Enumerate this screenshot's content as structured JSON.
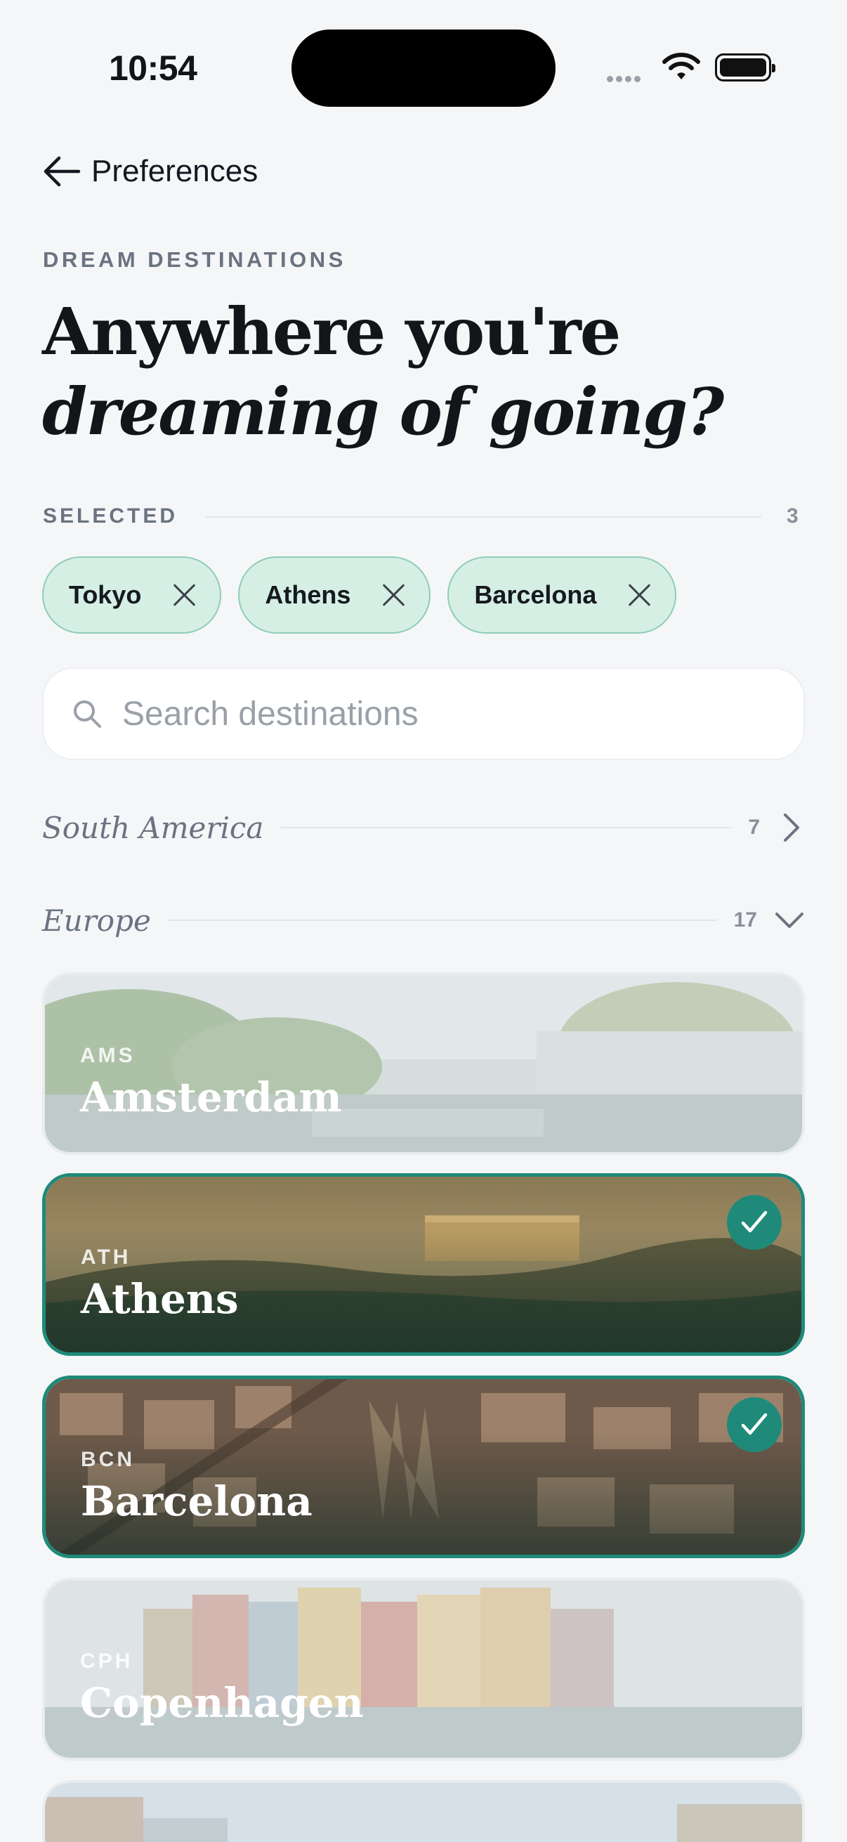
{
  "status_bar": {
    "time": "10:54"
  },
  "nav": {
    "back_label": "Preferences"
  },
  "header": {
    "eyebrow": "DREAM DESTINATIONS",
    "title_line1": "Anywhere you're",
    "title_line2": "dreaming of going?"
  },
  "selected": {
    "label": "SELECTED",
    "count": "3",
    "chips": [
      {
        "label": "Tokyo"
      },
      {
        "label": "Athens"
      },
      {
        "label": "Barcelona"
      }
    ]
  },
  "search": {
    "placeholder": "Search destinations",
    "value": ""
  },
  "regions": [
    {
      "name": "South America",
      "count": "7",
      "expanded": false
    },
    {
      "name": "Europe",
      "count": "17",
      "expanded": true
    }
  ],
  "destinations": [
    {
      "code": "AMS",
      "city": "Amsterdam",
      "selected": false
    },
    {
      "code": "ATH",
      "city": "Athens",
      "selected": true
    },
    {
      "code": "BCN",
      "city": "Barcelona",
      "selected": true
    },
    {
      "code": "CPH",
      "city": "Copenhagen",
      "selected": false
    }
  ],
  "colors": {
    "accent": "#1f8a7a",
    "chip_bg": "#d6efe5",
    "chip_border": "#8fcdb7",
    "page_bg": "#f4f6f8"
  }
}
